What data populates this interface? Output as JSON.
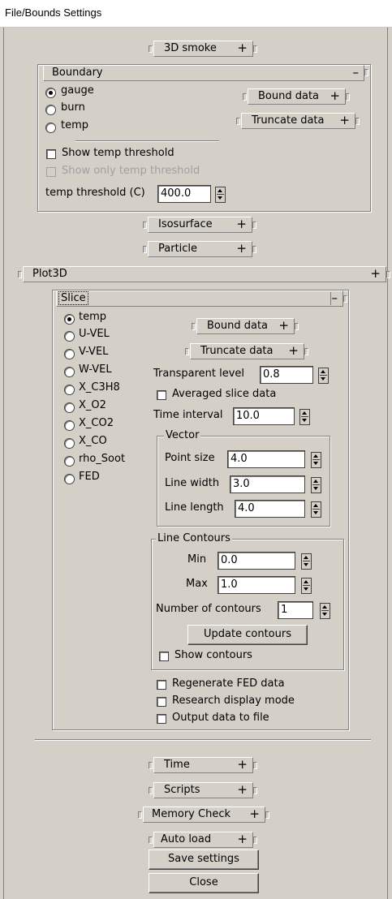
{
  "window": {
    "title": "File/Bounds Settings"
  },
  "rollouts": {
    "smoke3d": {
      "label": "3D smoke",
      "symbol": "+"
    },
    "boundary": {
      "label": "Boundary",
      "symbol": "–"
    },
    "isosurface": {
      "label": "Isosurface",
      "symbol": "+"
    },
    "particle": {
      "label": "Particle",
      "symbol": "+"
    },
    "plot3d": {
      "label": "Plot3D",
      "symbol": "+"
    },
    "slice": {
      "label": "Slice",
      "symbol": "–"
    },
    "time": {
      "label": "Time",
      "symbol": "+"
    },
    "scripts": {
      "label": "Scripts",
      "symbol": "+"
    },
    "memory": {
      "label": "Memory Check",
      "symbol": "+"
    },
    "autoload": {
      "label": "Auto load",
      "symbol": "+"
    }
  },
  "boundary": {
    "radios": [
      {
        "label": "gauge",
        "selected": true
      },
      {
        "label": "burn",
        "selected": false
      },
      {
        "label": "temp",
        "selected": false
      }
    ],
    "bound_data": {
      "label": "Bound data",
      "symbol": "+"
    },
    "truncate_data": {
      "label": "Truncate data",
      "symbol": "+"
    },
    "show_temp_threshold": "Show temp threshold",
    "show_only_temp_threshold": "Show only temp threshold",
    "temp_threshold_label": "temp threshold (C)",
    "temp_threshold_value": "400.0"
  },
  "slice": {
    "radios": [
      {
        "label": "temp",
        "selected": true
      },
      {
        "label": "U-VEL",
        "selected": false
      },
      {
        "label": "V-VEL",
        "selected": false
      },
      {
        "label": "W-VEL",
        "selected": false
      },
      {
        "label": "X_C3H8",
        "selected": false
      },
      {
        "label": "X_O2",
        "selected": false
      },
      {
        "label": "X_CO2",
        "selected": false
      },
      {
        "label": "X_CO",
        "selected": false
      },
      {
        "label": "rho_Soot",
        "selected": false
      },
      {
        "label": "FED",
        "selected": false
      }
    ],
    "bound_data": {
      "label": "Bound data",
      "symbol": "+"
    },
    "truncate_data": {
      "label": "Truncate data",
      "symbol": "+"
    },
    "transparent_level_label": "Transparent level",
    "transparent_level_value": "0.8",
    "averaged_slice_data": "Averaged slice data",
    "time_interval_label": "Time interval",
    "time_interval_value": "10.0",
    "vector": {
      "title": "Vector",
      "point_size_label": "Point size",
      "point_size_value": "4.0",
      "line_width_label": "Line width",
      "line_width_value": "3.0",
      "line_length_label": "Line length",
      "line_length_value": "4.0"
    },
    "contours": {
      "title": "Line Contours",
      "min_label": "Min",
      "min_value": "0.0",
      "max_label": "Max",
      "max_value": "1.0",
      "num_label": "Number of contours",
      "num_value": "1",
      "update_label": "Update contours",
      "show_label": "Show contours"
    },
    "regenerate_fed": "Regenerate FED data",
    "research_mode": "Research display mode",
    "output_file": "Output data to file"
  },
  "buttons": {
    "save": "Save settings",
    "close": "Close"
  }
}
